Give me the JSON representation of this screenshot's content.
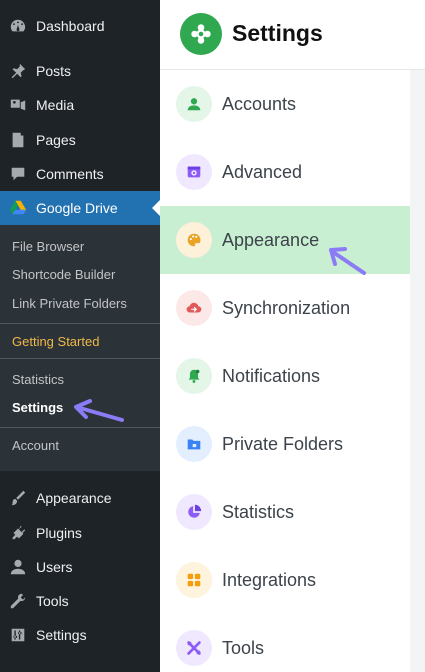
{
  "wp_menu": {
    "top_items": [
      {
        "label": "Dashboard",
        "icon": "dashboard-icon"
      },
      {
        "label": "Posts",
        "icon": "pin-icon"
      },
      {
        "label": "Media",
        "icon": "media-icon"
      },
      {
        "label": "Pages",
        "icon": "pages-icon"
      },
      {
        "label": "Comments",
        "icon": "comments-icon"
      }
    ],
    "active_item": {
      "label": "Google Drive",
      "icon": "google-drive-icon"
    },
    "submenu": {
      "file_browser": "File Browser",
      "shortcode_builder": "Shortcode Builder",
      "link_private_folders": "Link Private Folders",
      "getting_started": "Getting Started",
      "statistics": "Statistics",
      "settings": "Settings",
      "account": "Account"
    },
    "bottom_items": [
      {
        "label": "Appearance",
        "icon": "brush-icon"
      },
      {
        "label": "Plugins",
        "icon": "plugin-icon"
      },
      {
        "label": "Users",
        "icon": "users-icon"
      },
      {
        "label": "Tools",
        "icon": "wrench-icon"
      },
      {
        "label": "Settings",
        "icon": "settings-sliders-icon"
      }
    ]
  },
  "panel": {
    "title": "Settings",
    "logo_icon": "gear-icon",
    "nav": [
      {
        "label": "Accounts",
        "icon": "user-icon",
        "color": "#2fa84f"
      },
      {
        "label": "Advanced",
        "icon": "advanced-icon",
        "color": "#8b5cf6"
      },
      {
        "label": "Appearance",
        "icon": "palette-icon",
        "color": "#e8a427",
        "active": true
      },
      {
        "label": "Synchronization",
        "icon": "sync-cloud-icon",
        "color": "#e05a5a"
      },
      {
        "label": "Notifications",
        "icon": "bell-icon",
        "color": "#2fa84f"
      },
      {
        "label": "Private Folders",
        "icon": "folder-icon",
        "color": "#3b82f6"
      },
      {
        "label": "Statistics",
        "icon": "pie-chart-icon",
        "color": "#8b5cf6"
      },
      {
        "label": "Integrations",
        "icon": "integrations-icon",
        "color": "#f59e0b"
      },
      {
        "label": "Tools",
        "icon": "tools-icon",
        "color": "#8b5cf6"
      }
    ]
  },
  "colors": {
    "sidebar_bg": "#1d2327",
    "submenu_bg": "#2c3338",
    "active_blue": "#2271b1",
    "active_nav_bg": "#c9efd3",
    "brand_green": "#2fa84f",
    "annotation_arrow": "#8b7cf6",
    "getting_started": "#f0b849"
  }
}
